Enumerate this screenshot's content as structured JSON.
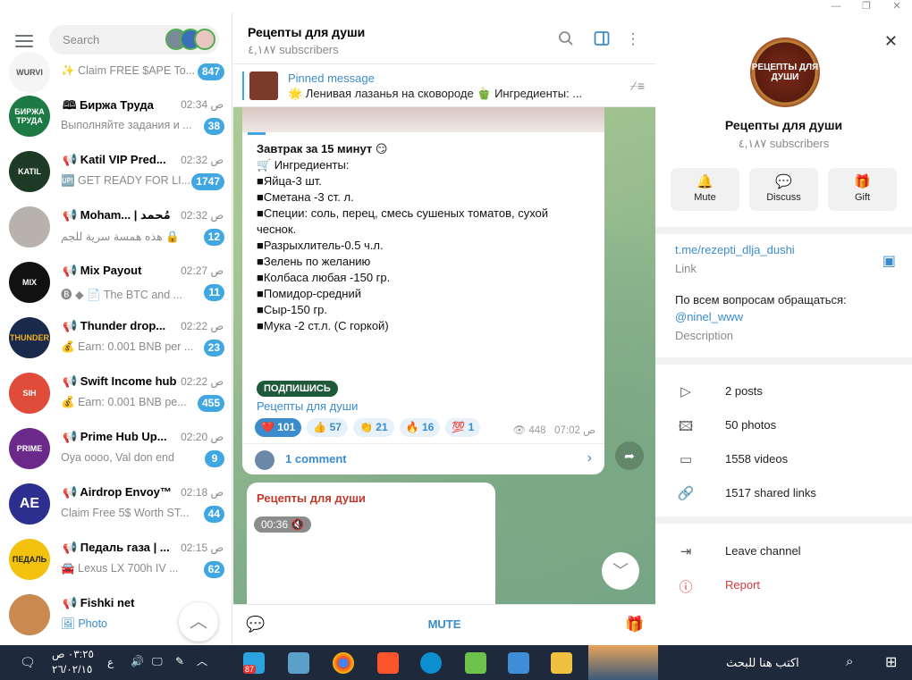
{
  "window": {
    "controls": [
      "—",
      "❐",
      "✕"
    ]
  },
  "left": {
    "search_placeholder": "Search",
    "chats": [
      {
        "name": "",
        "time": "",
        "preview": "✨ Claim FREE $APE To...",
        "badge": "847",
        "avatar_text": "WURVI",
        "avatar_color": "#f5f5f5"
      },
      {
        "name": "🕮 Биржа Труда",
        "time": "02:34 ص",
        "preview": "Выполняйте задания и ...",
        "badge": "38",
        "avatar_text": "БИРЖА ТРУДА",
        "avatar_color": "#1d7a44"
      },
      {
        "name": "📢 Katil VIP Pred...",
        "time": "02:32 ص",
        "preview": "🆙 GET READY FOR LI...",
        "badge": "1747",
        "avatar_text": "KATIL",
        "avatar_color": "#1c3a24"
      },
      {
        "name": "📢 Moham... | مُحمد",
        "time": "02:32 ص",
        "preview": "هذه همسة سرية للجم 🔒",
        "badge": "12",
        "avatar_text": "",
        "avatar_color": "#b7b2ae"
      },
      {
        "name": "📢 Mix Payout",
        "time": "02:27 ص",
        "preview": "🅑 ◆ 📄 The BTC and ...",
        "badge": "11",
        "avatar_text": "MIX",
        "avatar_color": "#111111"
      },
      {
        "name": "📢 Thunder drop...",
        "time": "02:22 ص",
        "preview": "💰 Earn: 0.001 BNB per ...",
        "badge": "23",
        "avatar_text": "THUNDER",
        "avatar_color": "#1a2a4a"
      },
      {
        "name": "📢 Swift Income hub",
        "time": "02:22 ص",
        "preview": "💰 Earn: 0.001 BNB pe...",
        "badge": "455",
        "avatar_text": "SIH",
        "avatar_color": "#e04b3a"
      },
      {
        "name": "📢 Prime Hub Up...",
        "time": "02:20 ص",
        "preview": "Oya oooo, Val don end",
        "badge": "9",
        "avatar_text": "PRIME",
        "avatar_color": "#6b2a8a"
      },
      {
        "name": "📢 Airdrop Envoy™",
        "time": "02:18 ص",
        "preview": "Claim Free 5$ Worth ST...",
        "badge": "44",
        "avatar_text": "AE",
        "avatar_color": "#2d2f8f"
      },
      {
        "name": "📢 Педаль газа | ...",
        "time": "02:15 ص",
        "preview": "🚘 Lexus LX 700h IV ...",
        "badge": "62",
        "avatar_text": "ПЕДАЛЬ",
        "avatar_color": "#f2c20f"
      },
      {
        "name": "📢 Fishki net",
        "time": "",
        "preview": "🖼 Photo",
        "badge": "",
        "avatar_text": "",
        "avatar_color": "#c9894f"
      }
    ]
  },
  "mid": {
    "title": "Рецепты для души",
    "subs": "٤,١٨٧ subscribers",
    "pinned_label": "Pinned message",
    "pinned_text": "🌟 Ленивая лазанья на сковороде 🫑 Ингредиенты: ...",
    "post_lines": [
      "Завтрак за 15 минут 😏",
      "",
      "🛒 Ингредиенты:",
      "",
      "■Яйца-3 шт.",
      "■Сметана -3 ст. л.",
      "■Специи: соль, перец, смесь сушеных томатов, сухой",
      "чеснок.",
      "■Разрыхлитель-0.5 ч.л.",
      "■Зелень по желанию",
      "■Колбаса любая -150 гр.",
      "■Помидор-средний",
      "■Сыр-150 гр.",
      "■Мука -2 ст.л. (С горкой)"
    ],
    "subscribe_badge": "ПОДПИШИСЬ",
    "subscribe_link": "Рецепты для души",
    "reactions": [
      {
        "emoji": "❤️",
        "count": "101",
        "mine": true
      },
      {
        "emoji": "👍",
        "count": "57",
        "mine": false
      },
      {
        "emoji": "👏",
        "count": "21",
        "mine": false
      },
      {
        "emoji": "🔥",
        "count": "16",
        "mine": false
      },
      {
        "emoji": "💯",
        "count": "1",
        "mine": false
      }
    ],
    "views": "448",
    "time": "07:02 ص",
    "comments": "1 comment",
    "next_author": "Рецепты для души",
    "video_duration": "00:36",
    "mute": "MUTE"
  },
  "right": {
    "logo_text": "РЕЦЕПТЫ ДЛЯ ДУШИ",
    "name": "Рецепты для души",
    "subs": "٤,١٨٧ subscribers",
    "buttons": [
      {
        "label": "Mute",
        "icon": "🔔"
      },
      {
        "label": "Discuss",
        "icon": "💬"
      },
      {
        "label": "Gift",
        "icon": "🎁"
      }
    ],
    "link": "t.me/rezepti_dlja_dushi",
    "link_caption": "Link",
    "desc_line1": "По всем вопросам обращаться:",
    "desc_handle": "@ninel_www",
    "desc_caption": "Description",
    "media": [
      {
        "label": "2 posts",
        "icon": "▷"
      },
      {
        "label": "50 photos",
        "icon": "🖾"
      },
      {
        "label": "1558 videos",
        "icon": "▭"
      },
      {
        "label": "1517 shared links",
        "icon": "🔗"
      }
    ],
    "leave": "Leave channel",
    "report": "Report",
    "accent_red": "#d33a3a"
  },
  "taskbar": {
    "time": "٠٣:٢٥ ص",
    "date": "٢٦/٠٢/١٥",
    "lang": "ع",
    "search_text": "اكتب هنا للبحث",
    "telegram_badge": "87"
  }
}
